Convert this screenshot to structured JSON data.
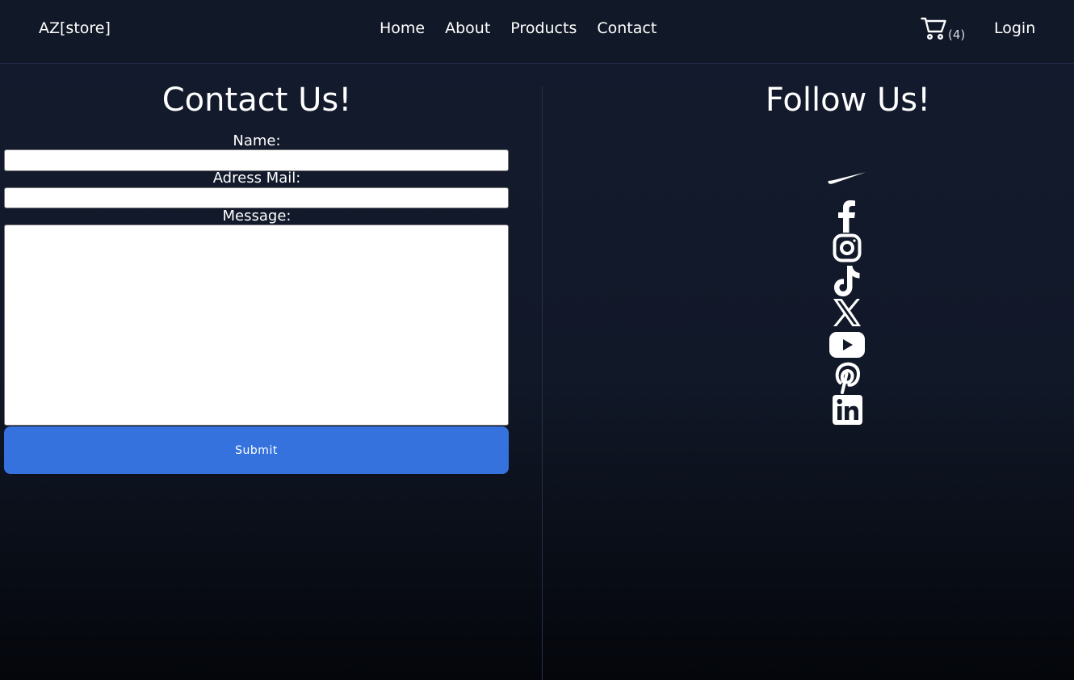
{
  "nav": {
    "brand": "AZ[store]",
    "links": [
      "Home",
      "About",
      "Products",
      "Contact"
    ],
    "cart_count": "(4)",
    "login": "Login"
  },
  "contact": {
    "title": "Contact Us!",
    "name_label": "Name:",
    "name_value": "",
    "email_label": "Adress Mail:",
    "email_value": "",
    "message_label": "Message:",
    "message_value": "",
    "submit_label": "Submit"
  },
  "follow": {
    "title": "Follow Us!",
    "icons": [
      "nike-icon",
      "facebook-icon",
      "instagram-icon",
      "tiktok-icon",
      "x-icon",
      "youtube-icon",
      "pinterest-icon",
      "linkedin-icon"
    ]
  },
  "colors": {
    "background": "#111827",
    "accent": "#3572de",
    "text": "#ffffff"
  }
}
